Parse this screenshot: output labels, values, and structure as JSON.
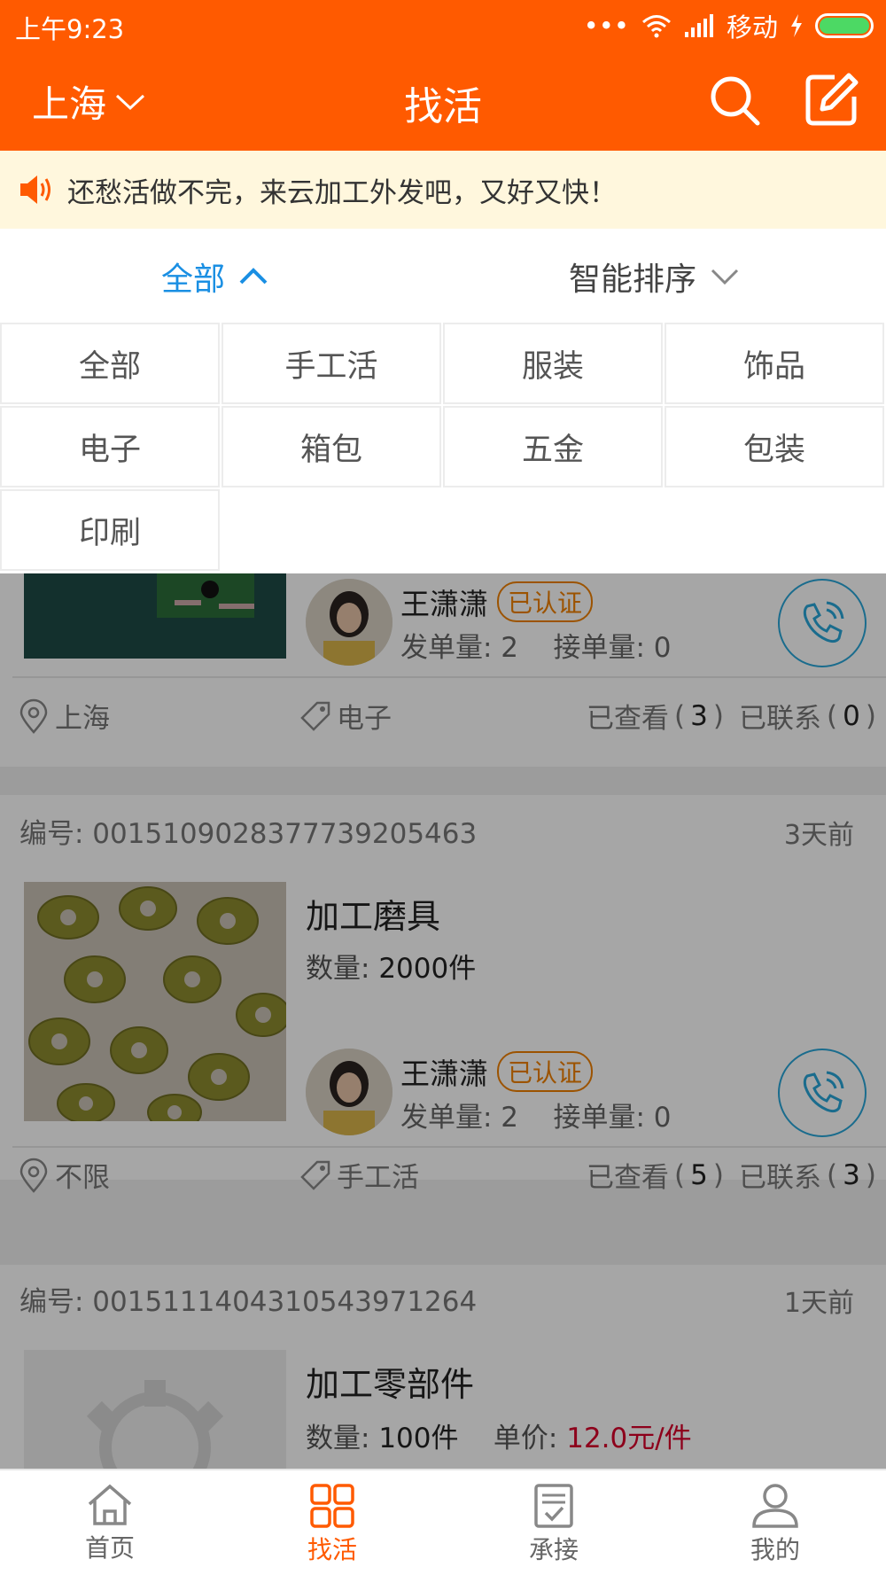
{
  "status_bar": {
    "time": "上午9:23",
    "carrier": "移动",
    "dots": "•••"
  },
  "header": {
    "city": "上海",
    "title": "找活",
    "search_icon": "search-icon",
    "edit_icon": "edit-icon"
  },
  "notice": {
    "text": "还愁活做不完，来云加工外发吧，又好又快！",
    "icon": "speaker-icon"
  },
  "filters": {
    "category": "全部",
    "sort": "智能排序"
  },
  "categories": [
    "全部",
    "手工活",
    "服装",
    "饰品",
    "电子",
    "箱包",
    "五金",
    "包装",
    "印刷"
  ],
  "listings": [
    {
      "user": "王潇潇",
      "badge": "已认证",
      "posted_label": "发单量: 2",
      "taken_label": "接单量: 0",
      "location": "上海",
      "tag": "电子",
      "viewed_label": "已查看",
      "viewed": "3",
      "contacted_label": "已联系",
      "contacted": "0"
    },
    {
      "code": "编号: 0015109028377739205463",
      "ago": "3天前",
      "title": "加工磨具",
      "qty_label": "数量: ",
      "qty_value": "2000件",
      "user": "王潇潇",
      "badge": "已认证",
      "posted_label": "发单量: 2",
      "taken_label": "接单量: 0",
      "location": "不限",
      "tag": "手工活",
      "viewed_label": "已查看",
      "viewed": "5",
      "contacted_label": "已联系",
      "contacted": "3"
    },
    {
      "code": "编号: 0015111404310543971264",
      "ago": "1天前",
      "title": "加工零部件",
      "qty_label": "数量: ",
      "qty_value": "100件",
      "price_label": "单价: ",
      "price_value": "12.0元/件"
    }
  ],
  "tabs": [
    {
      "label": "首页",
      "icon": "home-icon"
    },
    {
      "label": "找活",
      "icon": "grid-icon"
    },
    {
      "label": "承接",
      "icon": "clipboard-check-icon"
    },
    {
      "label": "我的",
      "icon": "person-icon"
    }
  ],
  "colors": {
    "brand": "#ff5a00",
    "accent": "#1a8fe3",
    "price": "#d9002a",
    "badge": "#f08000",
    "battery": "#4cd964"
  }
}
